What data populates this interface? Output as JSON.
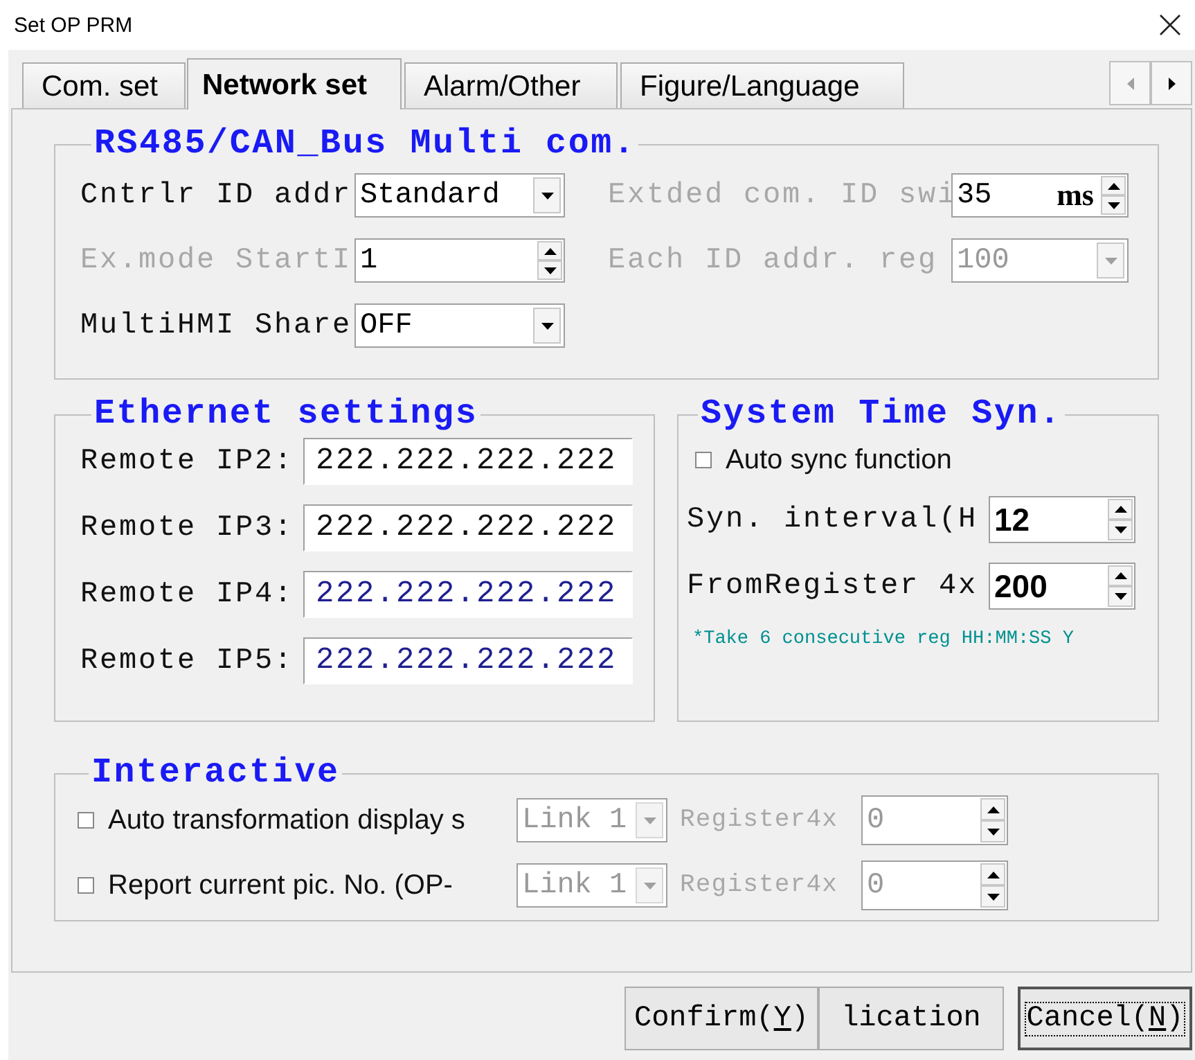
{
  "window": {
    "title": "Set OP PRM"
  },
  "tabs": [
    {
      "label": "Com. set",
      "selected": false
    },
    {
      "label": "Network set",
      "selected": true
    },
    {
      "label": "Alarm/Other",
      "selected": false
    },
    {
      "label": "Figure/Language",
      "selected": false
    }
  ],
  "rs485": {
    "title": "RS485/CAN_Bus Multi com.",
    "fields": [
      {
        "label": "Cntrlr ID addr",
        "kind": "dropdown",
        "value": "Standard",
        "disabled": false
      },
      {
        "label": "Extded com. ID swi",
        "kind": "spinner",
        "value": "35",
        "unit": "ms",
        "disabled": true
      },
      {
        "label": "Ex.mode StartI",
        "kind": "spinner",
        "value": "1",
        "disabled": true
      },
      {
        "label": "Each ID addr. reg",
        "kind": "dropdown",
        "value": "100",
        "disabled": true
      },
      {
        "label": "MultiHMI Share",
        "kind": "dropdown",
        "value": "OFF",
        "disabled": false
      }
    ]
  },
  "ethernet": {
    "title": "Ethernet settings",
    "rows": [
      {
        "label": "Remote IP2:",
        "value": "222.222.222.222",
        "highlighted": false
      },
      {
        "label": "Remote IP3:",
        "value": "222.222.222.222",
        "highlighted": false
      },
      {
        "label": "Remote IP4:",
        "value": "222.222.222.222",
        "highlighted": true
      },
      {
        "label": "Remote IP5:",
        "value": "222.222.222.222",
        "highlighted": true
      }
    ]
  },
  "time_sync": {
    "title": "System Time Syn.",
    "auto_sync": {
      "label": "Auto sync function",
      "checked": false
    },
    "fields": [
      {
        "label": "Syn. interval(H",
        "value": "12"
      },
      {
        "label": "FromRegister 4x",
        "value": "200"
      }
    ],
    "note": "*Take 6 consecutive reg HH:MM:SS Y"
  },
  "interactive": {
    "title": "Interactive",
    "rows": [
      {
        "label": "Auto transformation display s",
        "checked": false,
        "link": "Link 1",
        "register_label": "Register4x",
        "register": "0"
      },
      {
        "label": "Report current pic. No.  (OP-",
        "checked": false,
        "link": "Link 1",
        "register_label": "Register4x",
        "register": "0"
      }
    ]
  },
  "buttons": [
    {
      "text": "Confirm(",
      "key": "Y",
      "after": ")",
      "focused": false
    },
    {
      "text": "lication",
      "focused": false
    },
    {
      "text": "Cancel(",
      "key": "N",
      "after": ")",
      "focused": true
    }
  ]
}
